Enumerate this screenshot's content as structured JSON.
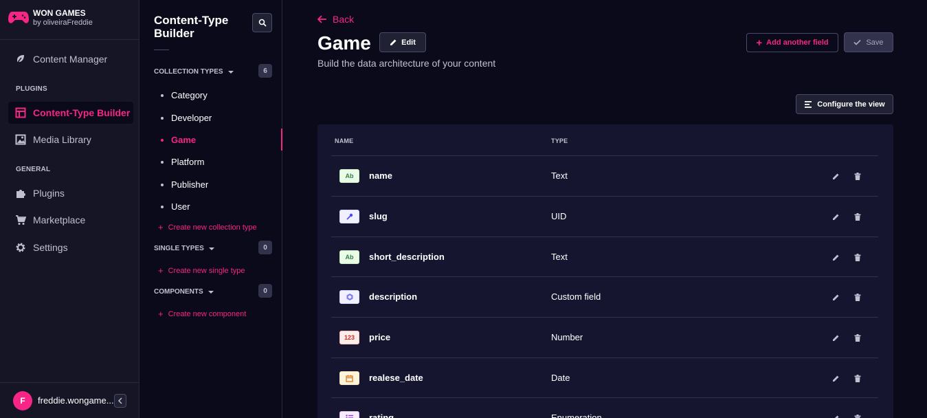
{
  "brand": {
    "title": "WON GAMES",
    "subtitle": "by oliveiraFreddie"
  },
  "main_nav": {
    "content_manager": "Content Manager",
    "plugins_section": "PLUGINS",
    "content_type_builder": "Content-Type Builder",
    "media_library": "Media Library",
    "general_section": "GENERAL",
    "plugins": "Plugins",
    "marketplace": "Marketplace",
    "settings": "Settings"
  },
  "profile": {
    "initial": "F",
    "name": "freddie.wongame..."
  },
  "sub_nav": {
    "title": "Content-Type Builder",
    "collection_types": {
      "label": "COLLECTION TYPES",
      "count": "6",
      "items": [
        "Category",
        "Developer",
        "Game",
        "Platform",
        "Publisher",
        "User"
      ],
      "active": "Game",
      "create": "Create new collection type"
    },
    "single_types": {
      "label": "SINGLE TYPES",
      "count": "0",
      "create": "Create new single type"
    },
    "components": {
      "label": "COMPONENTS",
      "count": "0",
      "create": "Create new component"
    }
  },
  "header": {
    "back": "Back",
    "title": "Game",
    "edit": "Edit",
    "subtitle": "Build the data architecture of your content",
    "add_field": "Add another field",
    "save": "Save",
    "configure_view": "Configure the view"
  },
  "table": {
    "columns": {
      "name": "NAME",
      "type": "TYPE"
    },
    "rows": [
      {
        "name": "name",
        "type": "Text",
        "icon": "text-icon",
        "icon_label": "Ab"
      },
      {
        "name": "slug",
        "type": "UID",
        "icon": "uid-key-icon",
        "icon_label": ""
      },
      {
        "name": "short_description",
        "type": "Text",
        "icon": "text-icon",
        "icon_label": "Ab"
      },
      {
        "name": "description",
        "type": "Custom field",
        "icon": "custom-field-icon",
        "icon_label": ""
      },
      {
        "name": "price",
        "type": "Number",
        "icon": "number-icon",
        "icon_label": "123"
      },
      {
        "name": "realese_date",
        "type": "Date",
        "icon": "calendar-icon",
        "icon_label": ""
      },
      {
        "name": "rating",
        "type": "Enumeration",
        "icon": "enumeration-icon",
        "icon_label": ""
      }
    ]
  },
  "colors": {
    "accent": "#f72585",
    "background": "#0a0a1a",
    "sidebar": "#151526",
    "card": "#151530"
  }
}
